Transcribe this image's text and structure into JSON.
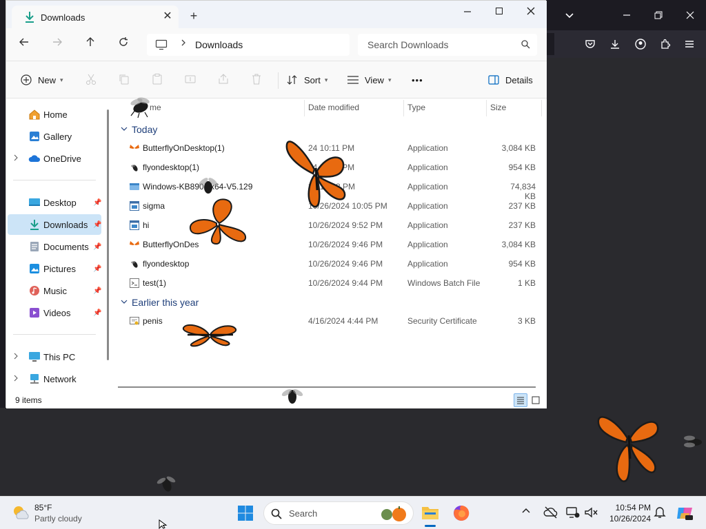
{
  "window": {
    "tab_title": "Downloads",
    "new_tab_symbol": "+",
    "close_symbol": "✕"
  },
  "nav": {
    "breadcrumb": "Downloads",
    "search_placeholder": "Search Downloads"
  },
  "toolbar": {
    "new_label": "New",
    "sort_label": "Sort",
    "view_label": "View",
    "more_label": "•••",
    "details_label": "Details"
  },
  "sidebar": {
    "items": [
      {
        "label": "Home"
      },
      {
        "label": "Gallery"
      },
      {
        "label": "OneDrive"
      },
      {
        "label": "Desktop"
      },
      {
        "label": "Downloads"
      },
      {
        "label": "Documents"
      },
      {
        "label": "Pictures"
      },
      {
        "label": "Music"
      },
      {
        "label": "Videos"
      },
      {
        "label": "This PC"
      },
      {
        "label": "Network"
      }
    ]
  },
  "columns": {
    "name": "me",
    "date": "Date modified",
    "type": "Type",
    "size": "Size"
  },
  "groups": [
    {
      "label": "Today"
    },
    {
      "label": "Earlier this year"
    }
  ],
  "files": [
    {
      "name": "ButterflyOnDesktop(1)",
      "date": "24 10:11 PM",
      "type": "Application",
      "size": "3,084 KB",
      "icon": "butterfly-icon"
    },
    {
      "name": "flyondesktop(1)",
      "date": "24 10:11 PM",
      "type": "Application",
      "size": "954 KB",
      "icon": "fly-icon"
    },
    {
      "name": "Windows-KB890",
      "name_tail": "x64-V5.129",
      "date": "24 10:08 PM",
      "type": "Application",
      "size": "74,834 KB",
      "icon": "installer-icon"
    },
    {
      "name": "sigma",
      "date": "10/26/2024 10:05 PM",
      "type": "Application",
      "size": "237 KB",
      "icon": "app-window-icon"
    },
    {
      "name": "hi",
      "date": "10/26/2024 9:52 PM",
      "type": "Application",
      "size": "237 KB",
      "icon": "app-window-icon"
    },
    {
      "name": "ButterflyOnDes",
      "date": "10/26/2024 9:46 PM",
      "type": "Application",
      "size": "3,084 KB",
      "icon": "butterfly-icon"
    },
    {
      "name": "flyondesktop",
      "date": "10/26/2024 9:46 PM",
      "type": "Application",
      "size": "954 KB",
      "icon": "fly-icon"
    },
    {
      "name": "test(1)",
      "date": "10/26/2024 9:44 PM",
      "type": "Windows Batch File",
      "size": "1 KB",
      "icon": "batch-file-icon"
    },
    {
      "name": "penis",
      "date": "4/16/2024 4:44 PM",
      "type": "Security Certificate",
      "size": "3 KB",
      "icon": "certificate-icon"
    }
  ],
  "status": {
    "item_count": "9 items"
  },
  "taskbar": {
    "weather_temp": "85°F",
    "weather_desc": "Partly cloudy",
    "search_label": "Search",
    "time": "10:54 PM",
    "date": "10/26/2024"
  },
  "colors": {
    "accent": "#0067c0",
    "selected": "#cce4f7",
    "butterfly_orange": "#e86a10",
    "group_header": "#1f3f7a"
  }
}
